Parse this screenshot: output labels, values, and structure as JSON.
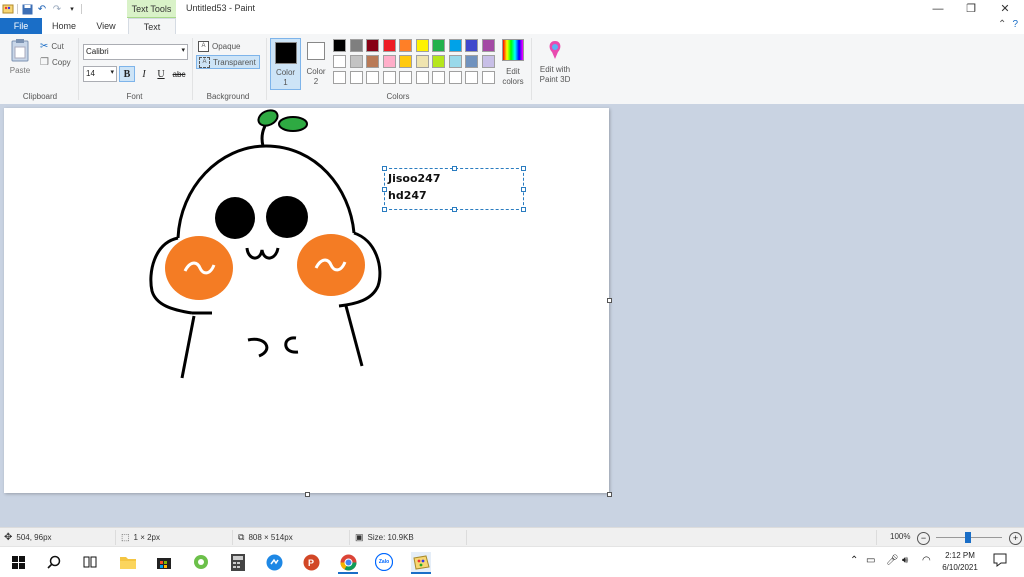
{
  "titlebar": {
    "context_tab": "Text Tools",
    "window_title": "Untitled53 - Paint",
    "minimize": "—",
    "restore": "❐",
    "close": "✕"
  },
  "tabs": {
    "file": "File",
    "home": "Home",
    "view": "View",
    "text": "Text"
  },
  "ribbon": {
    "clipboard": {
      "paste": "Paste",
      "cut": "Cut",
      "copy": "Copy",
      "label": "Clipboard"
    },
    "font": {
      "family": "Calibri",
      "size": "14",
      "bold": "B",
      "italic": "I",
      "underline": "U",
      "strike": "abc",
      "label": "Font"
    },
    "background": {
      "opaque": "Opaque",
      "transparent": "Transparent",
      "label": "Background"
    },
    "colors": {
      "color1": "Color 1",
      "color1_l1": "Color",
      "color1_l2": "1",
      "color2_l1": "Color",
      "color2_l2": "2",
      "label": "Colors",
      "edit_l1": "Edit",
      "edit_l2": "colors",
      "paint3d_l1": "Edit with",
      "paint3d_l2": "Paint 3D",
      "row1": [
        "#000000",
        "#7f7f7f",
        "#880015",
        "#ed1c24",
        "#ff7f27",
        "#fff200",
        "#22b14c",
        "#00a2e8",
        "#3f48cc",
        "#a349a4"
      ],
      "row2": [
        "#ffffff",
        "#c3c3c3",
        "#b97a57",
        "#ffaec9",
        "#ffc90e",
        "#efe4b0",
        "#b5e61d",
        "#99d9ea",
        "#7092be",
        "#c8bfe7"
      ],
      "row3": [
        "#ffffff",
        "#ffffff",
        "#ffffff",
        "#ffffff",
        "#ffffff",
        "#ffffff",
        "#ffffff",
        "#ffffff",
        "#ffffff",
        "#ffffff"
      ]
    }
  },
  "canvas": {
    "text_line1": "Jisoo247",
    "text_line2": "hd247"
  },
  "status": {
    "cursor_pos": "504, 96px",
    "selection_size": "1 × 2px",
    "image_size": "808 × 514px",
    "file_size": "Size: 10.9KB",
    "zoom": "100%"
  },
  "taskbar": {
    "time": "2:12 PM",
    "date": "6/10/2021",
    "zalo": "Zalo"
  }
}
